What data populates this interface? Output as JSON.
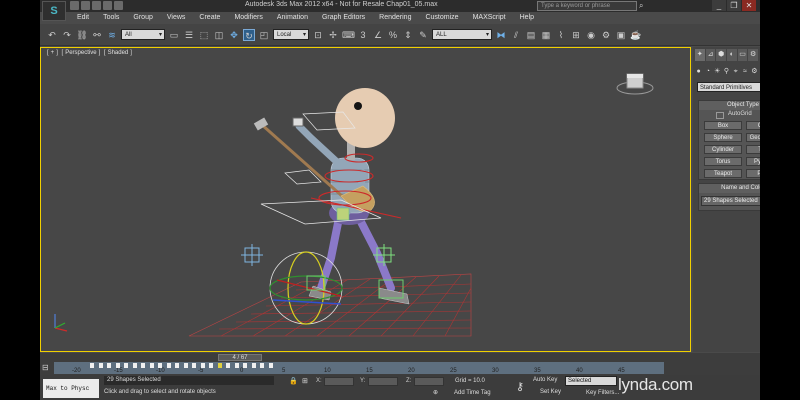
{
  "app": {
    "title": "Autodesk 3ds Max  2012 x64   -  Not for Resale    Chap01_05.max",
    "search_placeholder": "Type a keyword or phrase",
    "logo_glyph": "S",
    "window_buttons": [
      "_",
      "❐",
      "✕"
    ]
  },
  "menu": [
    "Edit",
    "Tools",
    "Group",
    "Views",
    "Create",
    "Modifiers",
    "Animation",
    "Graph Editors",
    "Rendering",
    "Customize",
    "MAXScript",
    "Help"
  ],
  "toolbar": {
    "selection_filter": "All",
    "reference_coord": "Local",
    "named_selection": "ALL"
  },
  "viewport": {
    "labels": [
      "[",
      "+",
      "]",
      "[",
      "Perspective",
      "]",
      "[",
      "Shaded",
      "]"
    ]
  },
  "command_panel": {
    "tabs": [
      "✦",
      "⊿",
      "⬢",
      "◐",
      "▭",
      "⚙"
    ],
    "category": "Standard Primitives",
    "object_type_title": "Object Type",
    "autogrid_label": "AutoGrid",
    "primitives": [
      "Box",
      "Cone",
      "Sphere",
      "GeoSphere",
      "Cylinder",
      "Tube",
      "Torus",
      "Pyramid",
      "Teapot",
      "Plane"
    ],
    "name_color_title": "Name and Color",
    "name_value": "29 Shapes Selected",
    "swatch_color": "#22c12a"
  },
  "timeline": {
    "frame_indicator": "4 / 67",
    "ticks": [
      "-20",
      "-15",
      "-10",
      "-5",
      "0",
      "5",
      "10",
      "15",
      "20",
      "25",
      "30",
      "35",
      "40",
      "45"
    ]
  },
  "status": {
    "maxscript": "Max to Physc",
    "selection": "29 Shapes Selected",
    "prompt": "Click and drag to select and rotate objects",
    "x_label": "X:",
    "y_label": "Y:",
    "z_label": "Z:",
    "grid": "Grid = 10.0",
    "add_time_tag": "Add Time Tag",
    "auto_key": "Auto Key",
    "set_key": "Set Key",
    "selected": "Selected",
    "key_filters": "Key Filters..."
  },
  "watermark": "lynda.com"
}
